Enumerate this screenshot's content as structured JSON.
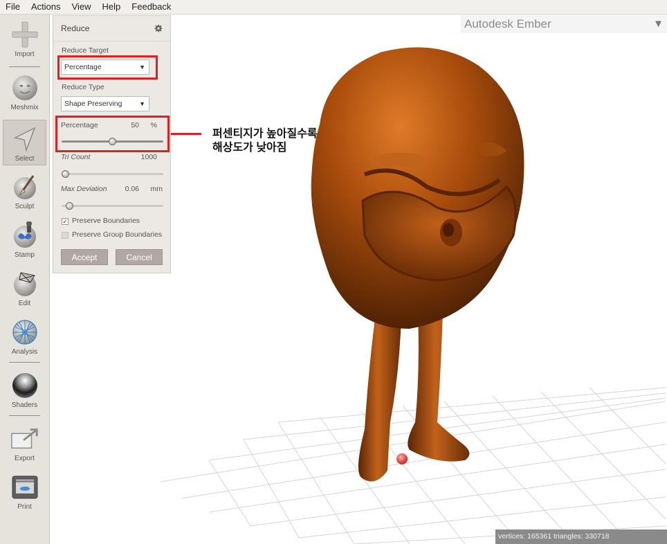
{
  "menu": [
    "File",
    "Actions",
    "View",
    "Help",
    "Feedback"
  ],
  "toolbar": {
    "import": "Import",
    "meshmix": "Meshmix",
    "select": "Select",
    "sculpt": "Sculpt",
    "stamp": "Stamp",
    "edit": "Edit",
    "analysis": "Analysis",
    "shaders": "Shaders",
    "export": "Export",
    "print": "Print"
  },
  "panel": {
    "title": "Reduce",
    "reduce_target_label": "Reduce Target",
    "reduce_target_value": "Percentage",
    "reduce_type_label": "Reduce Type",
    "reduce_type_value": "Shape Preserving",
    "percentage_label": "Percentage",
    "percentage_value": "50",
    "percentage_unit": "%",
    "percentage_fraction": 0.5,
    "tri_count_label": "Tri Count",
    "tri_count_value": "1000",
    "max_deviation_label": "Max Deviation",
    "max_deviation_value": "0.06",
    "max_deviation_unit": "mm",
    "preserve_boundaries": "Preserve Boundaries",
    "preserve_group_boundaries": "Preserve Group Boundaries",
    "accept": "Accept",
    "cancel": "Cancel"
  },
  "annotation": {
    "line1": "퍼센티지가 높아질수록",
    "line2": "해상도가 낮아짐",
    "color": "#e02020"
  },
  "viewport": {
    "printer": "Autodesk Ember",
    "status": "vertices: 165361 triangles: 330718",
    "model_color": "#b25412"
  }
}
